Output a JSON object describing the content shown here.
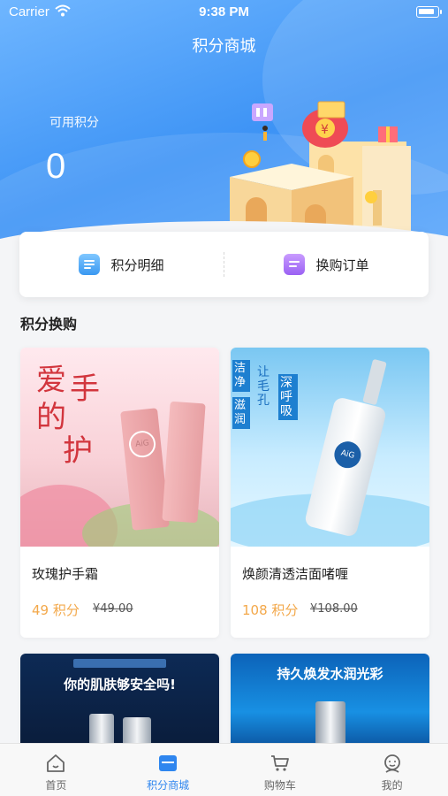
{
  "status": {
    "carrier": "Carrier",
    "time": "9:38 PM"
  },
  "header": {
    "title": "积分商城",
    "points_label": "可用积分",
    "points_value": "0"
  },
  "actions": [
    {
      "label": "积分明细",
      "icon": "points-detail-icon"
    },
    {
      "label": "换购订单",
      "icon": "exchange-order-icon"
    }
  ],
  "section": {
    "title": "积分换购"
  },
  "products": [
    {
      "name": "玫瑰护手霜",
      "points": "49 积分",
      "original_price": "¥49.00",
      "image_text": {
        "line1": "爱",
        "line2": "手",
        "line3": "的",
        "line4": "护",
        "brand": "AiG"
      }
    },
    {
      "name": "焕颜清透洁面啫喱",
      "points": "108 积分",
      "original_price": "¥108.00",
      "image_text": {
        "line1": "洁净",
        "line2": "滋润",
        "line3": "让毛孔",
        "line4": "深呼吸",
        "brand": "AiG"
      }
    },
    {
      "name": "",
      "points": "",
      "original_price": "",
      "image_text": {
        "line1": "你的肌肤够安全吗!"
      }
    },
    {
      "name": "",
      "points": "",
      "original_price": "",
      "image_text": {
        "line1": "持久焕发水润光彩"
      }
    }
  ],
  "tabbar": [
    {
      "label": "首页",
      "icon": "home-icon",
      "active": false
    },
    {
      "label": "积分商城",
      "icon": "points-mall-icon",
      "active": true
    },
    {
      "label": "购物车",
      "icon": "cart-icon",
      "active": false
    },
    {
      "label": "我的",
      "icon": "profile-icon",
      "active": false
    }
  ],
  "colors": {
    "accent": "#2f86ef",
    "price": "#f3a84a",
    "header_blue": "#4a9cf6"
  }
}
